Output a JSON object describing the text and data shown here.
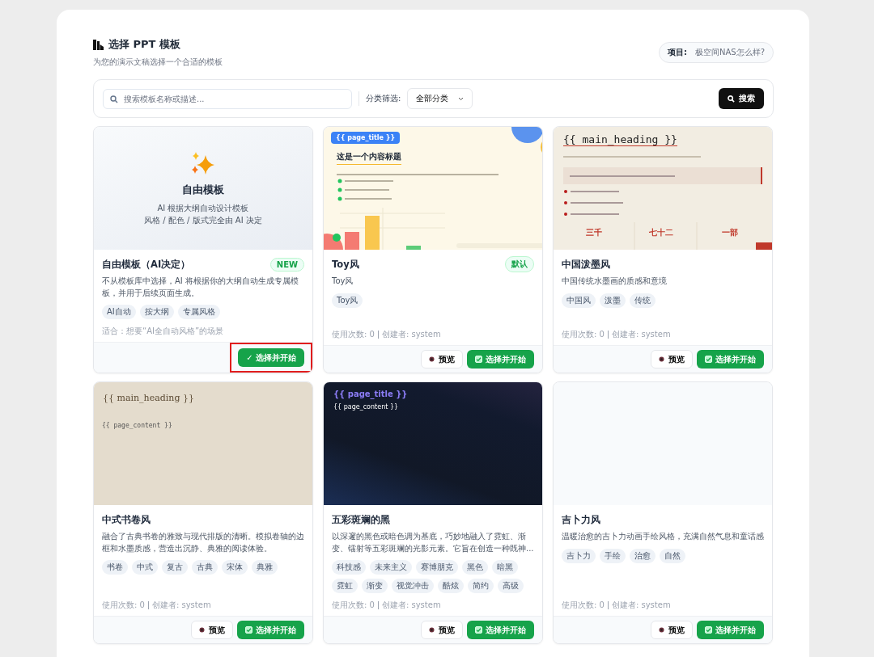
{
  "header": {
    "title": "选择 PPT 模板",
    "subtitle": "为您的演示文稿选择一个合适的模板",
    "project_label": "项目:",
    "project_name": "极空间NAS怎么样?"
  },
  "toolbar": {
    "search": {
      "placeholder": "搜索模板名称或描述..."
    },
    "filter_label": "分类筛选:",
    "filter_value": "全部分类",
    "search_button": "搜索"
  },
  "templates": [
    {
      "kind": "ai",
      "highlighted": true,
      "preview": {
        "kind": "ai",
        "heading": "自由模板",
        "lines": [
          "AI 根据大纲自动设计模板",
          "风格 / 配色 / 版式完全由 AI 决定"
        ]
      },
      "name": "自由模板（AI决定）",
      "badge": "NEW",
      "description": "不从模板库中选择，AI 将根据你的大纲自动生成专属模板，并用于后续页面生成。",
      "tags": [
        "AI自动",
        "按大纲",
        "专属风格"
      ],
      "note": "适合：想要“AI全自动风格”的场景",
      "select_button": "✓ 选择并开始"
    },
    {
      "kind": "template",
      "highlighted": false,
      "preview": {
        "kind": "toy",
        "heading": "{{ page_title }}",
        "subheading": "这是一个内容标题"
      },
      "name": "Toy风",
      "badge": "默认",
      "description": "Toy风",
      "tags": [
        "Toy风"
      ],
      "usage": "使用次数: 0",
      "creator": "创建者: system",
      "preview_button": "预览",
      "select_button": "选择并开始"
    },
    {
      "kind": "template",
      "highlighted": false,
      "preview": {
        "kind": "ink",
        "heading": "{{ main_heading }}",
        "stats": [
          "三千",
          "七十二",
          "一部"
        ]
      },
      "name": "中国泼墨风",
      "description": "中国传统水墨画的质感和意境",
      "tags": [
        "中国风",
        "泼墨",
        "传统"
      ],
      "usage": "使用次数: 0",
      "creator": "创建者: system",
      "preview_button": "预览",
      "select_button": "选择并开始"
    },
    {
      "kind": "template",
      "highlighted": false,
      "preview": {
        "kind": "scroll",
        "heading": "{{ main_heading }}",
        "subheading": "{{ page_content }}"
      },
      "name": "中式书卷风",
      "description": "融合了古典书卷的雅致与现代排版的清晰。模拟卷轴的边框和水墨质感，营造出沉静、典雅的阅读体验。",
      "tags": [
        "书卷",
        "中式",
        "复古",
        "古典",
        "宋体",
        "典雅"
      ],
      "usage": "使用次数: 0",
      "creator": "创建者: system",
      "preview_button": "预览",
      "select_button": "选择并开始"
    },
    {
      "kind": "template",
      "highlighted": false,
      "preview": {
        "kind": "dark",
        "heading": "{{ page_title }}",
        "subheading": "{{ page_content }}"
      },
      "name": "五彩斑斓的黑",
      "description": "以深邃的黑色或暗色调为基底，巧妙地融入了霓虹、渐变、镭射等五彩斑斓的光影元素。它旨在创造一种既神...",
      "tags": [
        "科技感",
        "未来主义",
        "赛博朋克",
        "黑色",
        "暗黑",
        "霓虹",
        "渐变",
        "视觉冲击",
        "酷炫",
        "简约",
        "高级"
      ],
      "usage": "使用次数: 0",
      "creator": "创建者: system",
      "preview_button": "预览",
      "select_button": "选择并开始"
    },
    {
      "kind": "template",
      "highlighted": false,
      "preview": {
        "kind": "blank"
      },
      "name": "吉卜力风",
      "description": "温暖治愈的吉卜力动画手绘风格，充满自然气息和童话感",
      "tags": [
        "吉卜力",
        "手绘",
        "治愈",
        "自然"
      ],
      "usage": "使用次数: 0",
      "creator": "创建者: system",
      "preview_button": "预览",
      "select_button": "选择并开始"
    }
  ]
}
